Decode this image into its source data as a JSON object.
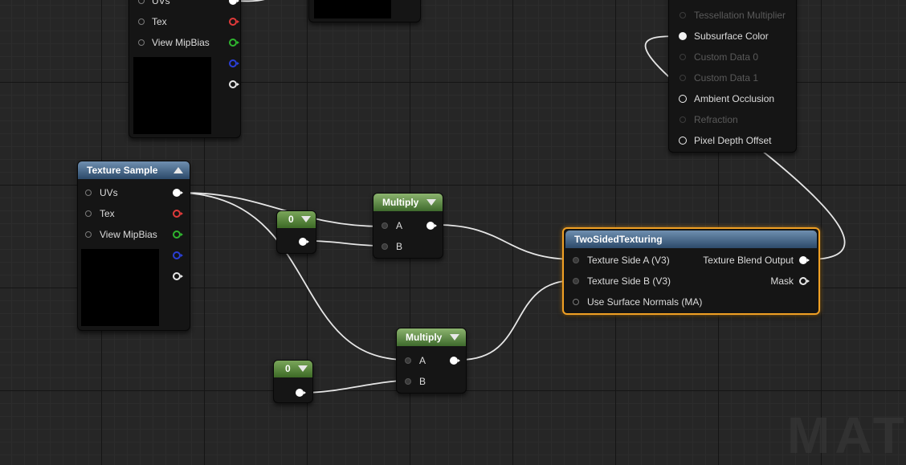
{
  "watermark": "MATE",
  "node_top_left": {
    "pins": [
      "UVs",
      "Tex",
      "View MipBias"
    ]
  },
  "texture_sample": {
    "title": "Texture Sample",
    "pins": [
      "UVs",
      "Tex",
      "View MipBias"
    ]
  },
  "const_1": {
    "value": "0"
  },
  "const_2": {
    "value": "0"
  },
  "multiply_1": {
    "title": "Multiply",
    "pin_a": "A",
    "pin_b": "B"
  },
  "multiply_2": {
    "title": "Multiply",
    "pin_a": "A",
    "pin_b": "B"
  },
  "two_sided": {
    "title": "TwoSidedTexturing",
    "inputs": [
      "Texture Side A (V3)",
      "Texture Side B (V3)",
      "Use Surface Normals (MA)"
    ],
    "outputs": [
      "Texture Blend Output",
      "Mask"
    ]
  },
  "material_node": {
    "pins": [
      "Tessellation Multiplier",
      "Subsurface Color",
      "Custom Data 0",
      "Custom Data 1",
      "Ambient Occlusion",
      "Refraction",
      "Pixel Depth Offset"
    ]
  },
  "colors": {
    "selection": "#f0a024",
    "multiply_header": "#3e6a2c",
    "texture_header": "#2c4a6a",
    "pin_red": "#e03a3a",
    "pin_green": "#2fb52f",
    "pin_blue": "#2a3fd6"
  }
}
